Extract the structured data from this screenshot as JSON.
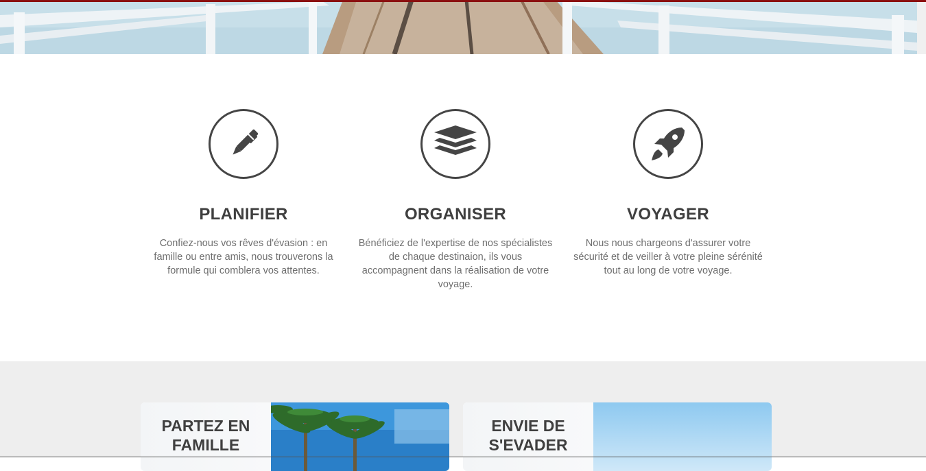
{
  "hero": {
    "image": "wooden-pier-over-sea"
  },
  "features": [
    {
      "icon": "pen-icon",
      "title": "PLANIFIER",
      "text": "Confiez-nous vos rêves d'évasion : en famille ou entre amis, nous trouverons la formule qui comblera vos attentes."
    },
    {
      "icon": "layers-icon",
      "title": "ORGANISER",
      "text": "Bénéficiez de l'expertise de nos spécialistes de chaque destinaion, ils vous accompagnent dans la réalisation de votre voyage."
    },
    {
      "icon": "rocket-icon",
      "title": "VOYAGER",
      "text": "Nous nous chargeons d'assurer votre sécurité et de veiller à votre pleine sérénité tout au long de votre voyage."
    }
  ],
  "cards": [
    {
      "title": "PARTEZ EN FAMILLE",
      "image": "palm-trees"
    },
    {
      "title": "ENVIE DE S'EVADER",
      "image": "blue-sky"
    }
  ],
  "colors": {
    "accent_bar": "#8b1010",
    "icon": "#454545",
    "heading": "#3f3f3f",
    "body_text": "#6e6e6e",
    "section_bg": "#eeeeee"
  }
}
